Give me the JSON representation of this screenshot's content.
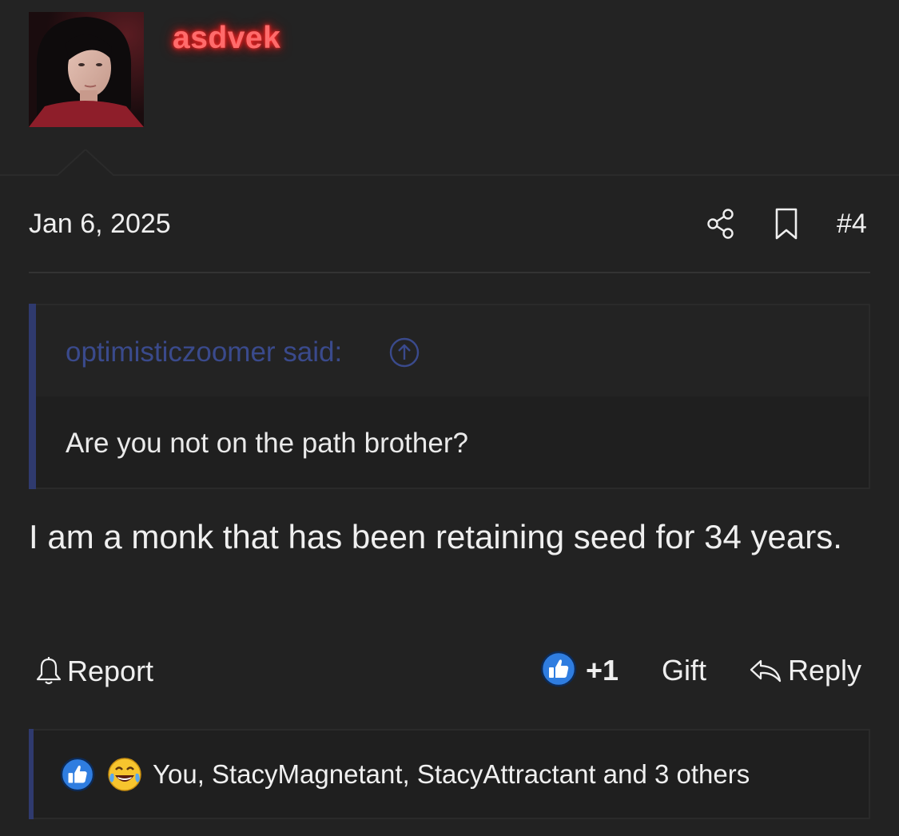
{
  "post": {
    "username": "asdvek",
    "date": "Jan 6, 2025",
    "number": "#4",
    "quote": {
      "author": "optimisticzoomer said:",
      "text": "Are you not on the path brother?"
    },
    "body": "I am a monk that has been retaining seed for 34 years."
  },
  "actions": {
    "report": "Report",
    "reaction_count": "+1",
    "gift": "Gift",
    "reply": "Reply"
  },
  "reactions": {
    "summary": "You, StacyMagnetant, StacyAttractant and 3 others",
    "icons": [
      "thumbs-up-icon",
      "tears-of-joy-icon"
    ]
  },
  "colors": {
    "background": "#222222",
    "username": "#ff6b6b",
    "quote_author": "#3a4a8c",
    "accent_bar": "#2f3a6e",
    "like_blue": "#2f7de0"
  }
}
